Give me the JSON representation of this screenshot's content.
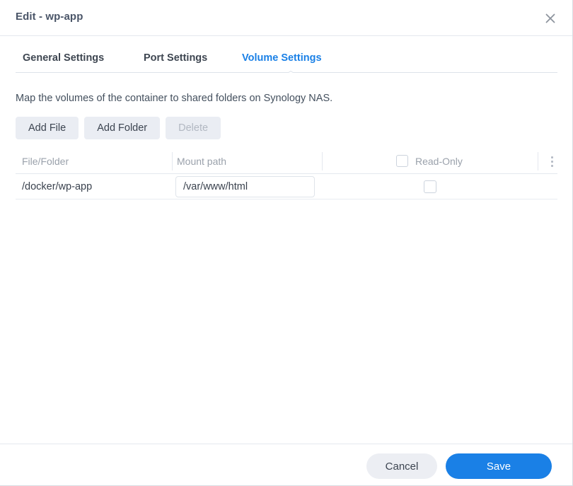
{
  "dialog": {
    "title": "Edit - wp-app",
    "close_icon": "close-icon"
  },
  "tabs": [
    {
      "label": "General Settings",
      "active": false
    },
    {
      "label": "Port Settings",
      "active": false
    },
    {
      "label": "Volume Settings",
      "active": true
    }
  ],
  "body": {
    "description": "Map the volumes of the container to shared folders on Synology NAS.",
    "toolbar": {
      "add_file_label": "Add File",
      "add_folder_label": "Add Folder",
      "delete_label": "Delete"
    },
    "table": {
      "columns": [
        "File/Folder",
        "Mount path",
        "Read-Only"
      ],
      "rows": [
        {
          "file_folder": "/docker/wp-app",
          "mount_path": "/var/www/html",
          "mount_path_placeholder": "Mount path",
          "read_only": false
        }
      ],
      "header_read_only_checked": false,
      "kebab_icon": "more-vertical-icon"
    }
  },
  "footer": {
    "cancel_label": "Cancel",
    "save_label": "Save"
  },
  "colors": {
    "accent_blue": "#1a80e6",
    "button_gray": "#eaedf3",
    "text_dark": "#3a424e",
    "text_muted": "#9aa1ab",
    "border": "#e4e8ee"
  }
}
